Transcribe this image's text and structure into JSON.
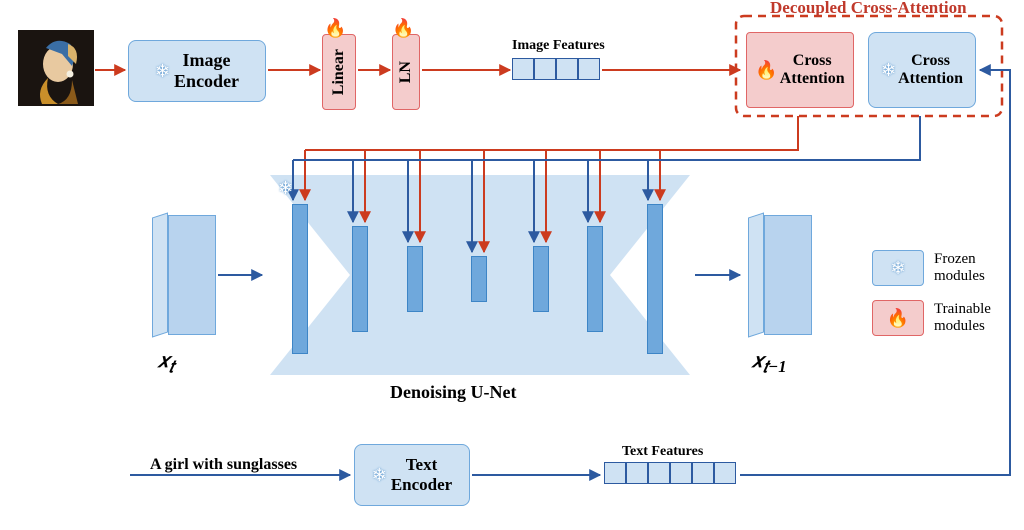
{
  "top": {
    "image_encoder": "Image\nEncoder",
    "linear": "Linear",
    "ln": "LN",
    "image_features": "Image Features",
    "decoupled_title": "Decoupled Cross-Attention",
    "cross_attention_img": "Cross\nAttention",
    "cross_attention_txt": "Cross\nAttention"
  },
  "mid": {
    "xt": "x_t",
    "xtm1": "x_{t-1}",
    "unet_label": "Denoising U-Net"
  },
  "bottom": {
    "prompt": "A girl with sunglasses",
    "text_encoder": "Text\nEncoder",
    "text_features": "Text Features"
  },
  "legend": {
    "frozen": "Frozen\nmodules",
    "trainable": "Trainable\nmodules"
  },
  "colors": {
    "frozen_bg": "#cfe2f3",
    "trainable_bg": "#f4cccc",
    "accent_red": "#cc3b1f",
    "accent_blue": "#2d5aa0"
  },
  "icons": {
    "snowflake": "❄",
    "fire": "🔥"
  },
  "arch": {
    "unet_bars": 7,
    "image_feature_cells": 4,
    "text_feature_cells": 6,
    "input_image_desc": "Girl with a Pearl Earring painting thumbnail"
  }
}
